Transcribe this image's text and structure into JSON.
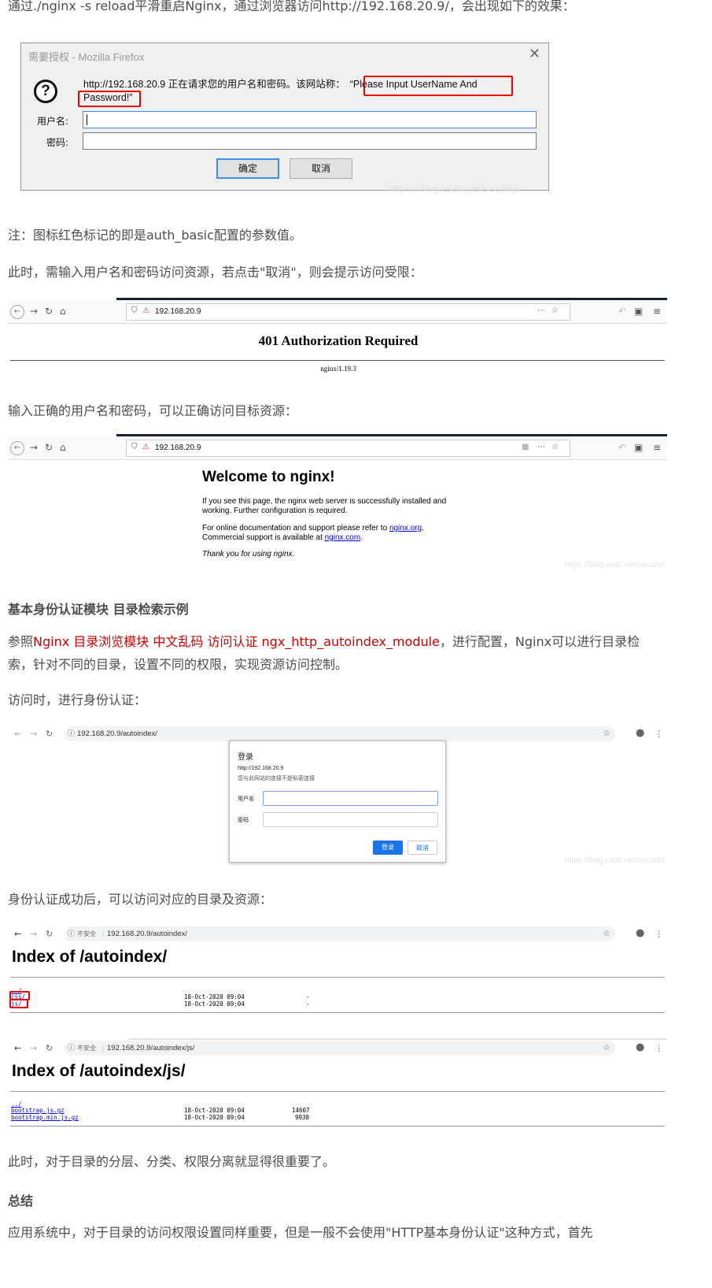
{
  "intro_text": "通过./nginx -s reload平滑重启Nginx，通过浏览器访问http://192.168.20.9/，会出现如下的效果：",
  "firefox_dialog": {
    "title": "需要授权 - Mozilla Firefox",
    "close_glyph": "✕",
    "message_line1": "http://192.168.20.9 正在请求您的用户名和密码。该网站称：",
    "realm_part1": "“Please Input UserName And",
    "realm_part2": "Password!”",
    "username_label": "用户名:",
    "password_label": "密码:",
    "ok_label": "确定",
    "cancel_label": "取消",
    "watermark": "https://blog.csdn.net/securitit"
  },
  "note_text": "注：图标红色标记的即是auth_basic配置的参数值。",
  "cancel_text": "此时，需输入用户名和密码访问资源，若点击\"取消\"，则会提示访问受限：",
  "ff_browser1": {
    "url": "192.168.20.9",
    "page_title": "401 Authorization Required",
    "footer": "nginx/1.19.3"
  },
  "correct_text": "输入正确的用户名和密码，可以正确访问目标资源：",
  "ff_browser2": {
    "url": "192.168.20.9",
    "welcome_title": "Welcome to nginx!",
    "line1": "If you see this page, the nginx web server is successfully installed and",
    "line2": "working. Further configuration is required.",
    "line3_pre": "For online documentation and support please refer to ",
    "line3_link": "nginx.org",
    "line3_post": ".",
    "line4_pre": "Commercial support is available at ",
    "line4_link": "nginx.com",
    "line4_post": ".",
    "thanks": "Thank you for using nginx.",
    "watermark": "https://blog.csdn.net/securitit"
  },
  "section_heading": "基本身份认证模块 目录检索示例",
  "ref_text_pre": "参照",
  "ref_link": "Nginx 目录浏览模块 中文乱码 访问认证 ngx_http_autoindex_module",
  "ref_text_post": "，进行配置，Nginx可以进行目录检",
  "ref_text_line2": "索，针对不同的目录，设置不同的权限，实现资源访问控制。",
  "auth_text": "访问时，进行身份认证：",
  "chrome_login": {
    "url": "192.168.20.9/autoindex/",
    "title": "登录",
    "host": "http://192.168.20.9",
    "insecure_note": "您与此网站的连接不是私密连接",
    "username_label": "用户名",
    "password_label": "密码",
    "login_button": "登录",
    "cancel_button": "取消",
    "watermark": "https://blog.csdn.net/securitit"
  },
  "success_text": "身份认证成功后，可以访问对应的目录及资源：",
  "index1": {
    "insecure": "不安全",
    "url": "192.168.20.9/autoindex/",
    "title": "Index of /autoindex/",
    "rows": [
      {
        "name": "../",
        "date": "",
        "size": ""
      },
      {
        "name": "css/",
        "date": "18-Oct-2020 09:04",
        "size": "-"
      },
      {
        "name": "js/",
        "date": "18-Oct-2020 09:04",
        "size": "-"
      }
    ]
  },
  "index2": {
    "insecure": "不安全",
    "url": "192.168.20.9/autoindex/js/",
    "title": "Index of /autoindex/js/",
    "rows": [
      {
        "name": "../",
        "date": "",
        "size": ""
      },
      {
        "name": "bootstrap.js.gz",
        "date": "18-Oct-2020 09:04",
        "size": "14607"
      },
      {
        "name": "bootstrap.min.js.gz",
        "date": "18-Oct-2020 09:04",
        "size": "9938"
      }
    ]
  },
  "separation_text": "此时，对于目录的分层、分类、权限分离就显得很重要了。",
  "summary_heading": "总结",
  "summary_text": "应用系统中，对于目录的访问权限设置同样重要，但是一般不会使用\"HTTP基本身份认证\"这种方式，首先"
}
